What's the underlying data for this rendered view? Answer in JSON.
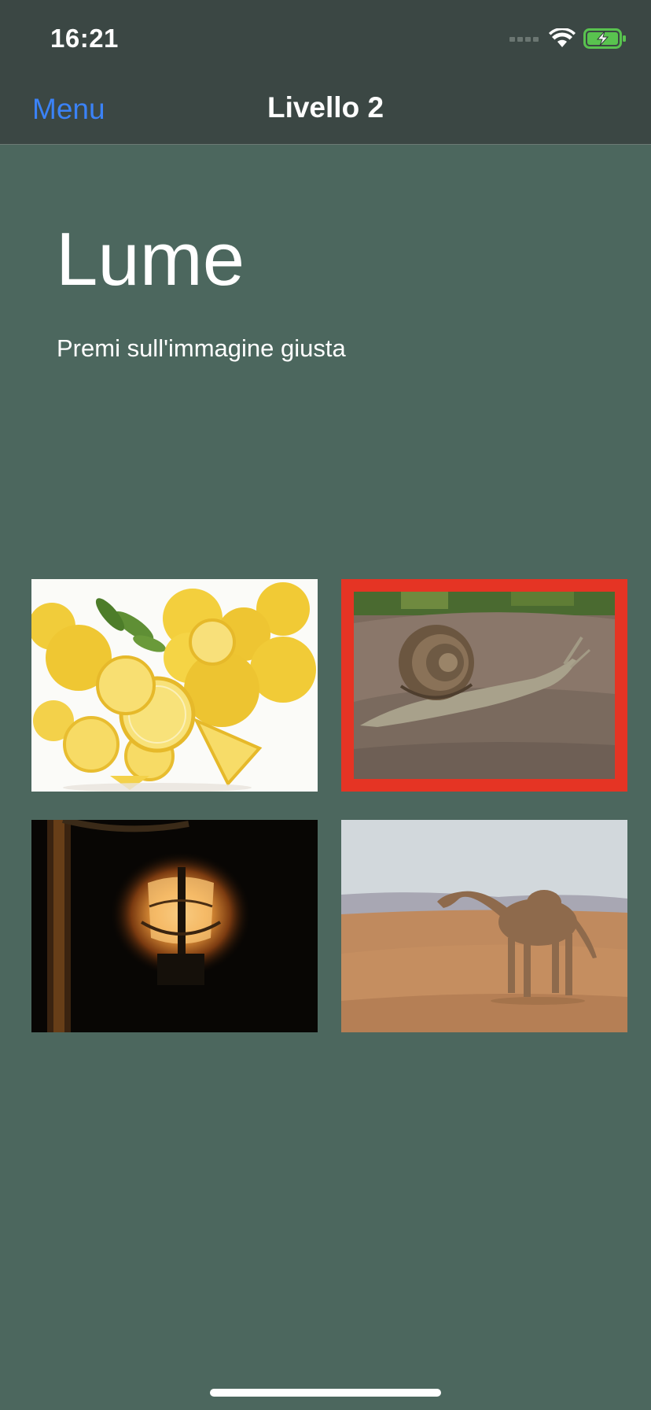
{
  "status_bar": {
    "time": "16:21",
    "icons": [
      "cellular-signal-icon",
      "wifi-icon",
      "battery-charging-icon"
    ],
    "battery_color": "#59c34f"
  },
  "nav": {
    "back_label": "Menu",
    "title": "Livello 2",
    "back_color": "#3b82f6"
  },
  "exercise": {
    "word": "Lume",
    "instruction": "Premi sull'immagine giusta"
  },
  "choices": [
    {
      "name": "lemons",
      "selected": false
    },
    {
      "name": "snail",
      "selected": true
    },
    {
      "name": "lantern",
      "selected": false
    },
    {
      "name": "camel",
      "selected": false
    }
  ],
  "colors": {
    "background": "#4c675e",
    "topbar": "#3b4744",
    "selection_border": "#e53424"
  }
}
